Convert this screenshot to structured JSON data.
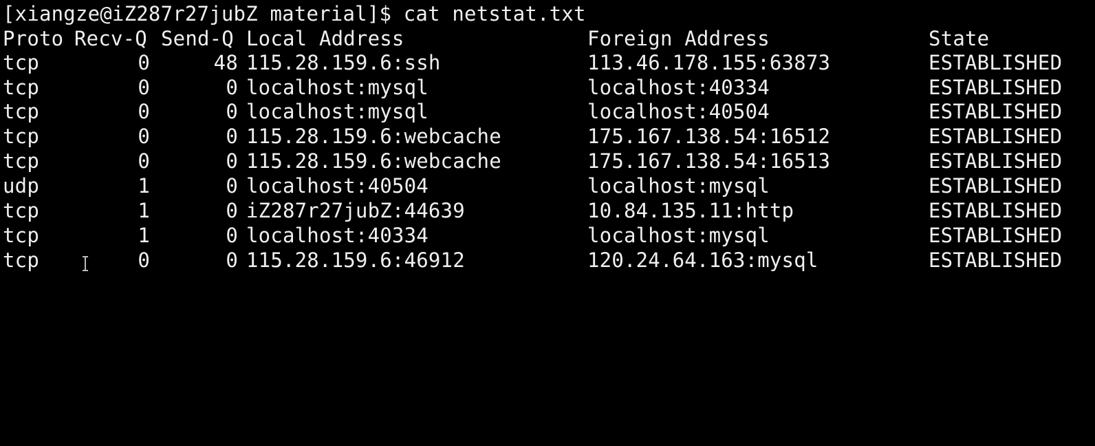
{
  "terminal": {
    "prompt": "[xiangze@iZ287r27jubZ material]$ cat netstat.txt",
    "headers": {
      "proto": "Proto",
      "recv_q": "Recv-Q",
      "send_q": "Send-Q",
      "local": "Local Address",
      "foreign": "Foreign Address",
      "state": "State"
    },
    "rows": [
      {
        "proto": "tcp",
        "recv_q": "0",
        "send_q": "48",
        "local": "115.28.159.6:ssh",
        "foreign": "113.46.178.155:63873",
        "state": "ESTABLISHED"
      },
      {
        "proto": "tcp",
        "recv_q": "0",
        "send_q": "0",
        "local": "localhost:mysql",
        "foreign": "localhost:40334",
        "state": "ESTABLISHED"
      },
      {
        "proto": "tcp",
        "recv_q": "0",
        "send_q": "0",
        "local": "localhost:mysql",
        "foreign": "localhost:40504",
        "state": "ESTABLISHED"
      },
      {
        "proto": "tcp",
        "recv_q": "0",
        "send_q": "0",
        "local": "115.28.159.6:webcache",
        "foreign": "175.167.138.54:16512",
        "state": "ESTABLISHED"
      },
      {
        "proto": "tcp",
        "recv_q": "0",
        "send_q": "0",
        "local": "115.28.159.6:webcache",
        "foreign": "175.167.138.54:16513",
        "state": "ESTABLISHED"
      },
      {
        "proto": "udp",
        "recv_q": "1",
        "send_q": "0",
        "local": "localhost:40504",
        "foreign": "localhost:mysql",
        "state": "ESTABLISHED"
      },
      {
        "proto": "tcp",
        "recv_q": "1",
        "send_q": "0",
        "local": "iZ287r27jubZ:44639",
        "foreign": "10.84.135.11:http",
        "state": "ESTABLISHED"
      },
      {
        "proto": "tcp",
        "recv_q": "1",
        "send_q": "0",
        "local": "localhost:40334",
        "foreign": "localhost:mysql",
        "state": "ESTABLISHED"
      },
      {
        "proto": "tcp",
        "recv_q": "0",
        "send_q": "0",
        "local": "115.28.159.6:46912",
        "foreign": "120.24.64.163:mysql",
        "state": "ESTABLISHED"
      }
    ]
  },
  "colors": {
    "background": "#000000",
    "foreground": "#efefef"
  },
  "icons": {
    "mouse_cursor": "text-cursor-icon"
  }
}
